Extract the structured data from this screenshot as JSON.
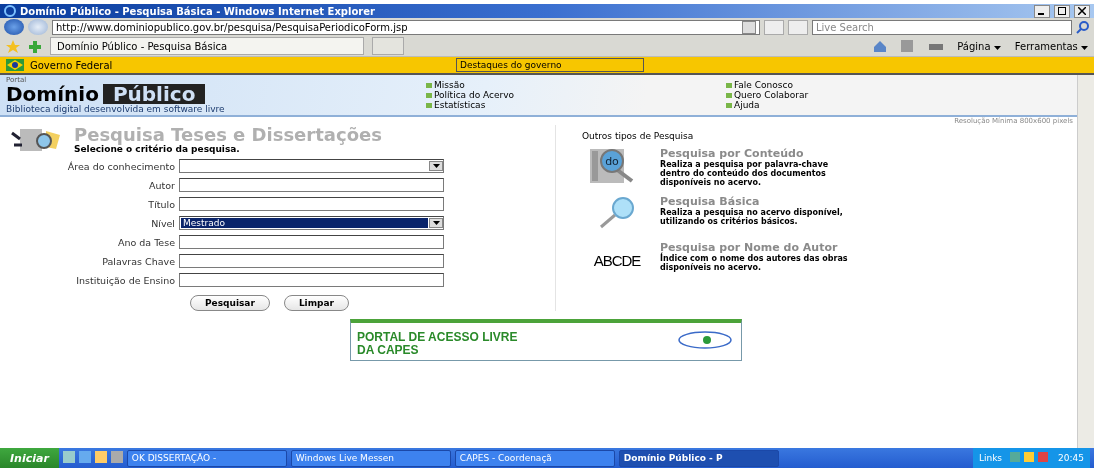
{
  "window": {
    "title": "Domínio Público - Pesquisa Básica - Windows Internet Explorer"
  },
  "address_bar": {
    "url": "http://www.dominiopublico.gov.br/pesquisa/PesquisaPeriodicoForm.jsp",
    "search_placeholder": "Live Search"
  },
  "tab": {
    "label": "Domínio Público - Pesquisa Básica"
  },
  "command_bar": [
    "Página",
    "Ferramentas"
  ],
  "gov_bar": {
    "label": "Governo Federal",
    "dropdown": "Destaques do governo"
  },
  "header": {
    "portal": "Portal",
    "logo_left": "Domínio",
    "logo_right": "Público",
    "tagline": "Biblioteca digital desenvolvida em software livre",
    "links_1": [
      "Missão",
      "Política do Acervo",
      "Estatísticas"
    ],
    "links_2": [
      "Fale Conosco",
      "Quero Colaborar",
      "Ajuda"
    ]
  },
  "resolution_note": "Resolução Mínima 800x600 pixels",
  "form": {
    "title": "Pesquisa Teses e Dissertações",
    "subtitle": "Selecione o critério da pesquisa.",
    "fields": [
      {
        "label": "Área do conhecimento",
        "kind": "select",
        "focused": false
      },
      {
        "label": "Autor",
        "kind": "text",
        "focused": false
      },
      {
        "label": "Título",
        "kind": "text",
        "focused": false
      },
      {
        "label": "Nível",
        "kind": "select",
        "value": "Mestrado",
        "focused": true
      },
      {
        "label": "Ano da Tese",
        "kind": "text",
        "focused": false
      },
      {
        "label": "Palavras Chave",
        "kind": "text",
        "focused": false
      },
      {
        "label": "Instituição de Ensino",
        "kind": "text",
        "focused": false
      }
    ],
    "buttons": [
      "Pesquisar",
      "Limpar"
    ]
  },
  "other_searches": {
    "heading": "Outros tipos de Pesquisa",
    "items": [
      {
        "kind": "content",
        "icon_text": "do",
        "title": "Pesquisa por Conteúdo",
        "description": "Realiza a pesquisa por palavra-chave dentro do conteúdo dos documentos disponíveis no acervo."
      },
      {
        "kind": "basic",
        "title": "Pesquisa Básica",
        "description": "Realiza a pesquisa no acervo disponível, utilizando os critérios básicos."
      },
      {
        "kind": "author",
        "icon_text": "ABCDE",
        "title": "Pesquisa por Nome do Autor",
        "description": "Índice com o nome dos autores das obras disponíveis no acervo."
      }
    ]
  },
  "banner": {
    "lines": [
      "PORTAL DE ACESSO LIVRE",
      "DA CAPES"
    ]
  },
  "taskbar": {
    "start": "Iniciar",
    "tasks": [
      {
        "label": "OK DISSERTAÇÃO -",
        "selected": false
      },
      {
        "label": "Windows Live Messen",
        "selected": false
      },
      {
        "label": "CAPES - Coordenaçã",
        "selected": false
      },
      {
        "label": "Domínio Público - P",
        "selected": true
      }
    ],
    "links": "Links",
    "clock": "20:45"
  }
}
